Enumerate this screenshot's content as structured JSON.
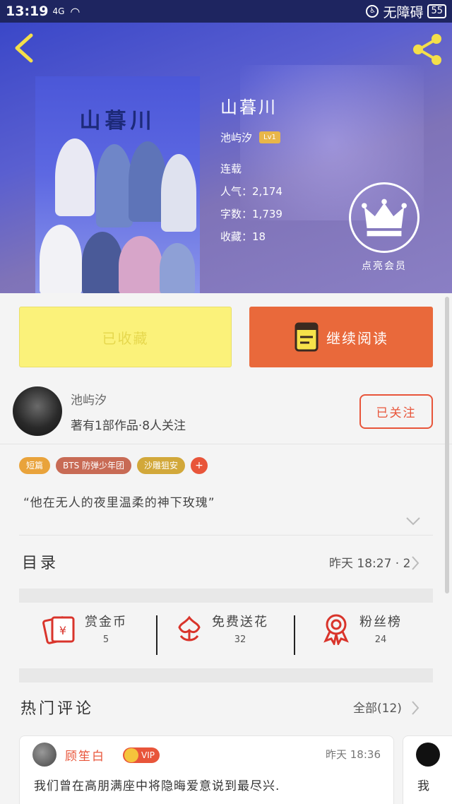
{
  "status_bar": {
    "time": "13:19",
    "signal": "4G",
    "accessibility": "无障碍",
    "battery": "55"
  },
  "book": {
    "cover_title": "山暮川",
    "title": "山暮川",
    "author": "池屿汐",
    "level": "Lv1",
    "status": "连载",
    "popularity_label": "人气：",
    "popularity": "2,174",
    "words_label": "字数：",
    "words": "1,739",
    "favorites_label": "收藏：",
    "favorites": "18",
    "vip_label": "点亮会员"
  },
  "actions": {
    "favorited": "已收藏",
    "continue_reading": "继续阅读"
  },
  "author_card": {
    "name": "池屿汐",
    "stats": "著有1部作品·8人关注",
    "follow_label": "已关注"
  },
  "tags": [
    {
      "label": "短篇",
      "color": "#e9a33b"
    },
    {
      "label": "BTS 防弹少年团",
      "color": "#c86b55"
    },
    {
      "label": "沙雕狙安",
      "color": "#d2a83a"
    },
    {
      "label": "+",
      "color": "#e8553a"
    }
  ],
  "quote": "“他在无人的夜里温柔的神下玫瑰”",
  "catalog": {
    "title": "目录",
    "updated": "昨天 18:27 · 2"
  },
  "rewards": [
    {
      "label": "赏金币",
      "count": "5"
    },
    {
      "label": "免费送花",
      "count": "32"
    },
    {
      "label": "粉丝榜",
      "count": "24"
    }
  ],
  "comments_section": {
    "title": "热门评论",
    "all_label": "全部(12)"
  },
  "comments": [
    {
      "user": "顾笙白",
      "badge": "VIP",
      "time": "昨天 18:36",
      "text": "我们曾在高朋满座中将隐晦爱意说到最尽兴."
    },
    {
      "text": "我"
    }
  ],
  "colors": {
    "accent": "#e8553a",
    "read_button": "#e9693b",
    "fav_button": "#fbf27a",
    "hero": "#4a55cf"
  },
  "icons": [
    "back-arrow-icon",
    "share-icon",
    "crown-icon",
    "book-icon",
    "red-envelope-icon",
    "flower-icon",
    "medal-icon",
    "chevron-right-icon",
    "chevron-down-icon"
  ]
}
